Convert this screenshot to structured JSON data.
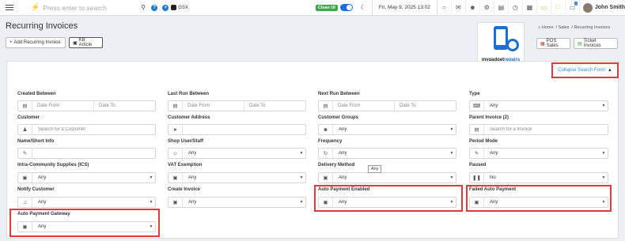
{
  "topbar": {
    "search_placeholder": "Press enter to search",
    "gsx_label": "GSX",
    "clean_ui_label": "Clean UI",
    "datetime": "Fri, May 9, 2025 13:02",
    "user_name": "John Smith",
    "icons": [
      "menu-icon",
      "bolt-icon",
      "search-icon",
      "help-icon",
      "add-icon",
      "apple-icon",
      "moon-icon",
      "chat-icon",
      "mail-icon",
      "users-icon",
      "settings-icon",
      "calculator-icon",
      "clock-icon",
      "grid-icon",
      "monitor-icon",
      "apps-icon",
      "notification-icon"
    ],
    "notification_count": "0"
  },
  "header": {
    "title": "Recurring Invoices",
    "add_button": "Add Recurring Invoice",
    "kb_button": "KB Article",
    "breadcrumb_home": "Home",
    "breadcrumb_sales": "Sales",
    "breadcrumb_current": "Recurring Invoices",
    "pos_sales": "POS Sales",
    "ticket_invoices": "Ticket Invoices"
  },
  "logo": {
    "text_a": "mygadget",
    "text_b": "repairs",
    "sub": ".com"
  },
  "search_form": {
    "collapse_label": "Collapse Search Form",
    "created_between": {
      "label": "Created Between",
      "from_placeholder": "Date From",
      "to_placeholder": "Date To"
    },
    "last_run_between": {
      "label": "Last Run Between",
      "from_placeholder": "Date From",
      "to_placeholder": "Date To"
    },
    "next_run_between": {
      "label": "Next Run Between",
      "from_placeholder": "Date From",
      "to_placeholder": "Date To"
    },
    "type": {
      "label": "Type",
      "value": "Any"
    },
    "customer": {
      "label": "Customer",
      "placeholder": "Search for a Customer"
    },
    "customer_address": {
      "label": "Customer Address",
      "value": ""
    },
    "customer_groups": {
      "label": "Customer Groups",
      "value": "Any"
    },
    "parent_invoice": {
      "label": "Parent Invoice (2)",
      "placeholder": "Search for a Invoice"
    },
    "name_short_info": {
      "label": "Name/Short Info",
      "value": ""
    },
    "shop_user_staff": {
      "label": "Shop User/Staff",
      "value": "Any"
    },
    "frequency": {
      "label": "Frequency",
      "value": "Any"
    },
    "period_mode": {
      "label": "Period Mode",
      "value": "Any"
    },
    "intra_community": {
      "label": "Intra-Community Supplies (ICS)",
      "value": "Any"
    },
    "vat_exemption": {
      "label": "VAT Exemption",
      "value": "Any"
    },
    "delivery_method": {
      "label": "Delivery Method",
      "value": "Any",
      "tooltip": "Any"
    },
    "paused": {
      "label": "Paused",
      "value": "No"
    },
    "notify_customer": {
      "label": "Notify Customer",
      "value": "Any"
    },
    "create_invoice": {
      "label": "Create Invoice",
      "value": "Any"
    },
    "auto_payment_enabled": {
      "label": "Auto Payment Enabled",
      "value": "Any"
    },
    "failed_auto_payment": {
      "label": "Failed Auto Payment",
      "value": "Any"
    },
    "auto_payment_gateway": {
      "label": "Auto Payment Gateway",
      "value": "Any"
    }
  }
}
